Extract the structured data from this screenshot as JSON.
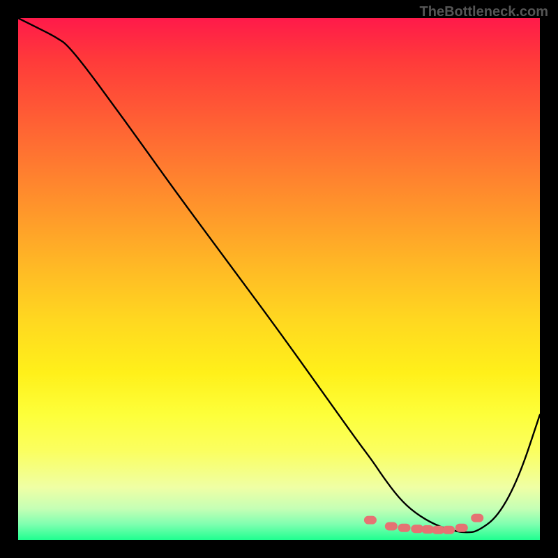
{
  "watermark": "TheBottleneck.com",
  "chart_data": {
    "type": "line",
    "title": "",
    "xlabel": "",
    "ylabel": "",
    "xlim": [
      0,
      100
    ],
    "ylim": [
      0,
      100
    ],
    "series": [
      {
        "name": "curve",
        "color": "#000000",
        "x": [
          0,
          4,
          7,
          10,
          20,
          30,
          40,
          50,
          60,
          65,
          68,
          70,
          73,
          76,
          80,
          84,
          86,
          88,
          92,
          96,
          100
        ],
        "y": [
          100,
          98,
          96.5,
          94.5,
          81,
          67,
          53.5,
          40,
          26,
          19,
          15,
          12,
          8,
          5.2,
          2.8,
          1.6,
          1.4,
          1.6,
          4.5,
          12,
          24
        ]
      }
    ],
    "markers": {
      "name": "highlight-dots",
      "color": "#e57373",
      "shape": "rounded-pill",
      "points": [
        {
          "x": 67.5,
          "y": 3.8
        },
        {
          "x": 71.5,
          "y": 2.6
        },
        {
          "x": 74.0,
          "y": 2.3
        },
        {
          "x": 76.5,
          "y": 2.1
        },
        {
          "x": 78.5,
          "y": 2.0
        },
        {
          "x": 80.5,
          "y": 1.9
        },
        {
          "x": 82.5,
          "y": 1.9
        },
        {
          "x": 85.0,
          "y": 2.3
        },
        {
          "x": 88.0,
          "y": 4.2
        }
      ]
    },
    "background_gradient": {
      "top": "#ff1a4a",
      "upper_mid": "#ffba25",
      "lower_mid": "#fbff60",
      "bottom": "#20ff90"
    }
  }
}
